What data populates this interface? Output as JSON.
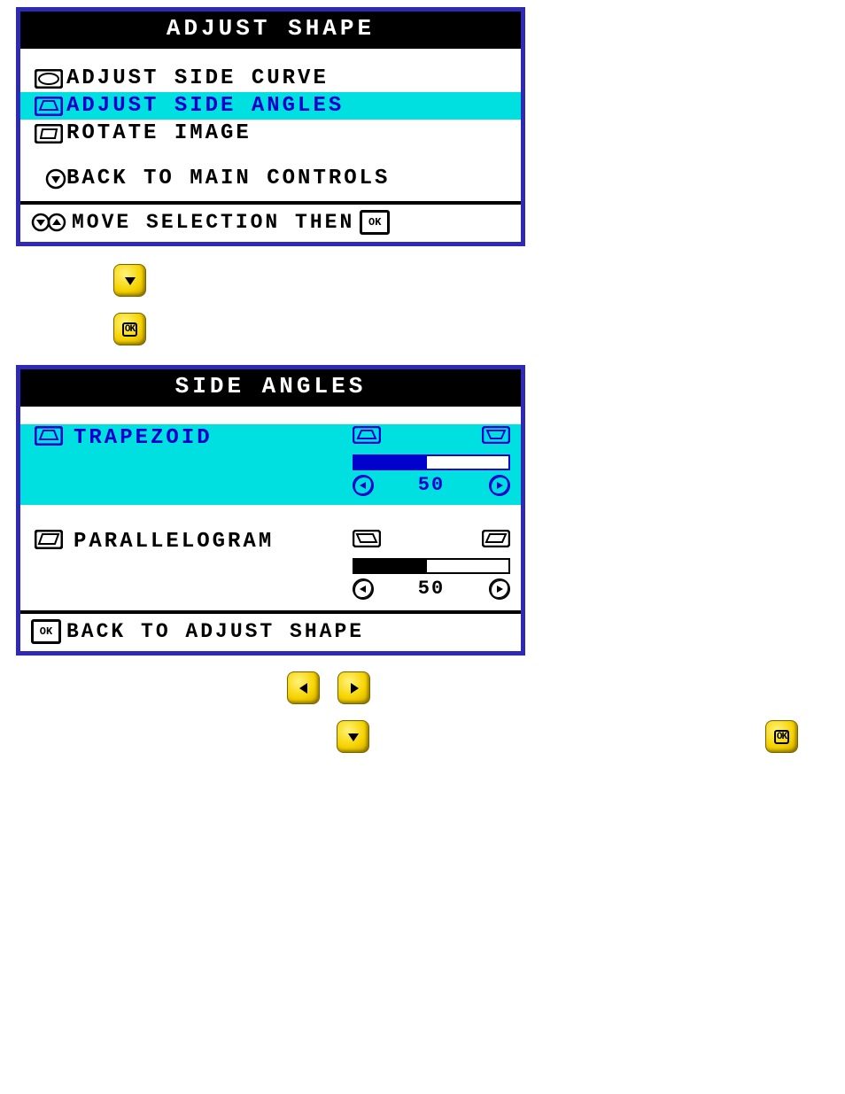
{
  "menu1": {
    "title": "ADJUST SHAPE",
    "items": [
      {
        "label": "ADJUST SIDE CURVE",
        "selected": false
      },
      {
        "label": "ADJUST SIDE ANGLES",
        "selected": true
      },
      {
        "label": "ROTATE IMAGE",
        "selected": false
      },
      {
        "label": "BACK TO MAIN CONTROLS",
        "selected": false
      }
    ],
    "footer_hint": "MOVE SELECTION THEN",
    "footer_ok": "OK"
  },
  "menu2": {
    "title": "SIDE ANGLES",
    "items": [
      {
        "label": "TRAPEZOID",
        "value": "50",
        "fill_pct": 47,
        "selected": true
      },
      {
        "label": "PARALLELOGRAM",
        "value": "50",
        "fill_pct": 47,
        "selected": false
      }
    ],
    "footer_ok": "OK",
    "footer_label": "BACK TO ADJUST SHAPE"
  },
  "buttons": {
    "down": "down-button",
    "ok": "ok-button",
    "left": "left-button",
    "right": "right-button"
  }
}
